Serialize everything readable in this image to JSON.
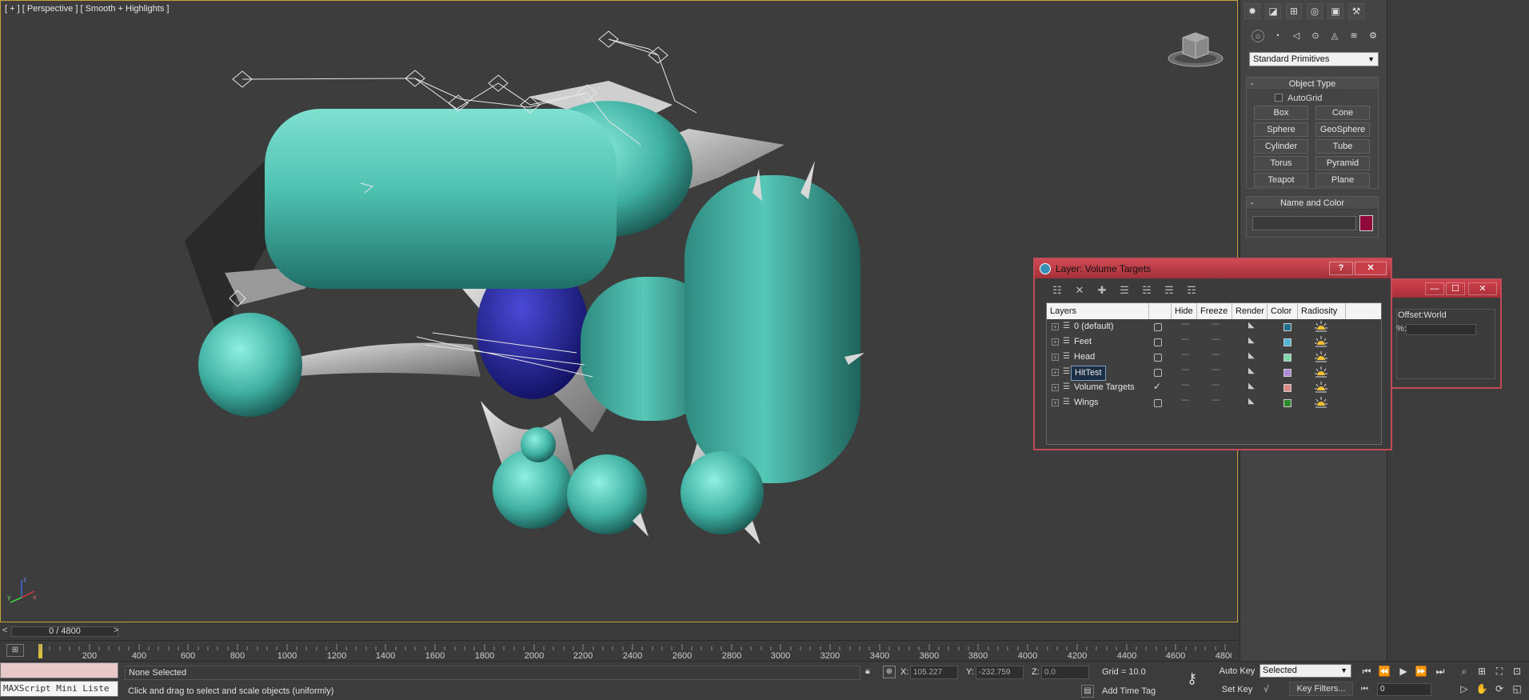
{
  "viewport": {
    "label": "[ + ] [ Perspective ] [ Smooth + Highlights ]",
    "axis": {
      "x": "x",
      "y": "y",
      "z": "z"
    }
  },
  "timeline": {
    "position": "0 / 4800",
    "prev": "<",
    "next": ">",
    "ticks": [
      "200",
      "400",
      "600",
      "800",
      "1000",
      "1200",
      "1400",
      "1600",
      "1800",
      "2000",
      "2200",
      "2400",
      "2600",
      "2800",
      "3000",
      "3200",
      "3400",
      "3600",
      "3800",
      "4000",
      "4200",
      "4400",
      "4600",
      "4800"
    ]
  },
  "status": {
    "maxscript": "MAXScript Mini Liste",
    "selection": "None Selected",
    "prompt": "Click and drag to select and scale objects (uniformly)",
    "x_label": "X:",
    "x_value": "105.227",
    "y_label": "Y:",
    "y_value": "-232.759",
    "z_label": "Z:",
    "z_value": "0.0",
    "grid": "Grid = 10.0",
    "add_time_tag": "Add Time Tag",
    "auto_key": "Auto Key",
    "set_key": "Set Key",
    "selected_option": "Selected",
    "key_filters": "Key Filters...",
    "frame": "0"
  },
  "command_panel": {
    "primitive_type": "Standard Primitives",
    "object_type": {
      "title": "Object Type",
      "autogrid": "AutoGrid",
      "buttons": [
        "Box",
        "Cone",
        "Sphere",
        "GeoSphere",
        "Cylinder",
        "Tube",
        "Torus",
        "Pyramid",
        "Teapot",
        "Plane"
      ]
    },
    "name_and_color": {
      "title": "Name and Color",
      "name": "",
      "color": "#8f0a3a"
    },
    "collapse": "-"
  },
  "back_dialog": {
    "offset_label": "Offset:World",
    "pct": "%:"
  },
  "layer_dialog": {
    "title": "Layer: Volume Targets",
    "help": "?",
    "close": "✕",
    "columns": [
      "Layers",
      "Hide",
      "Freeze",
      "Render",
      "Color",
      "Radiosity"
    ],
    "layers": [
      {
        "name": "0 (default)",
        "current": false,
        "color": "#1f6f8f"
      },
      {
        "name": "Feet",
        "current": false,
        "color": "#4fb6d8"
      },
      {
        "name": "Head",
        "current": false,
        "color": "#7ed8a8"
      },
      {
        "name": "HitTest",
        "current": false,
        "color": "#b08ad8",
        "selected": true
      },
      {
        "name": "Volume Targets",
        "current": true,
        "color": "#e08a8a"
      },
      {
        "name": "Wings",
        "current": false,
        "color": "#2c8a2c"
      }
    ]
  }
}
